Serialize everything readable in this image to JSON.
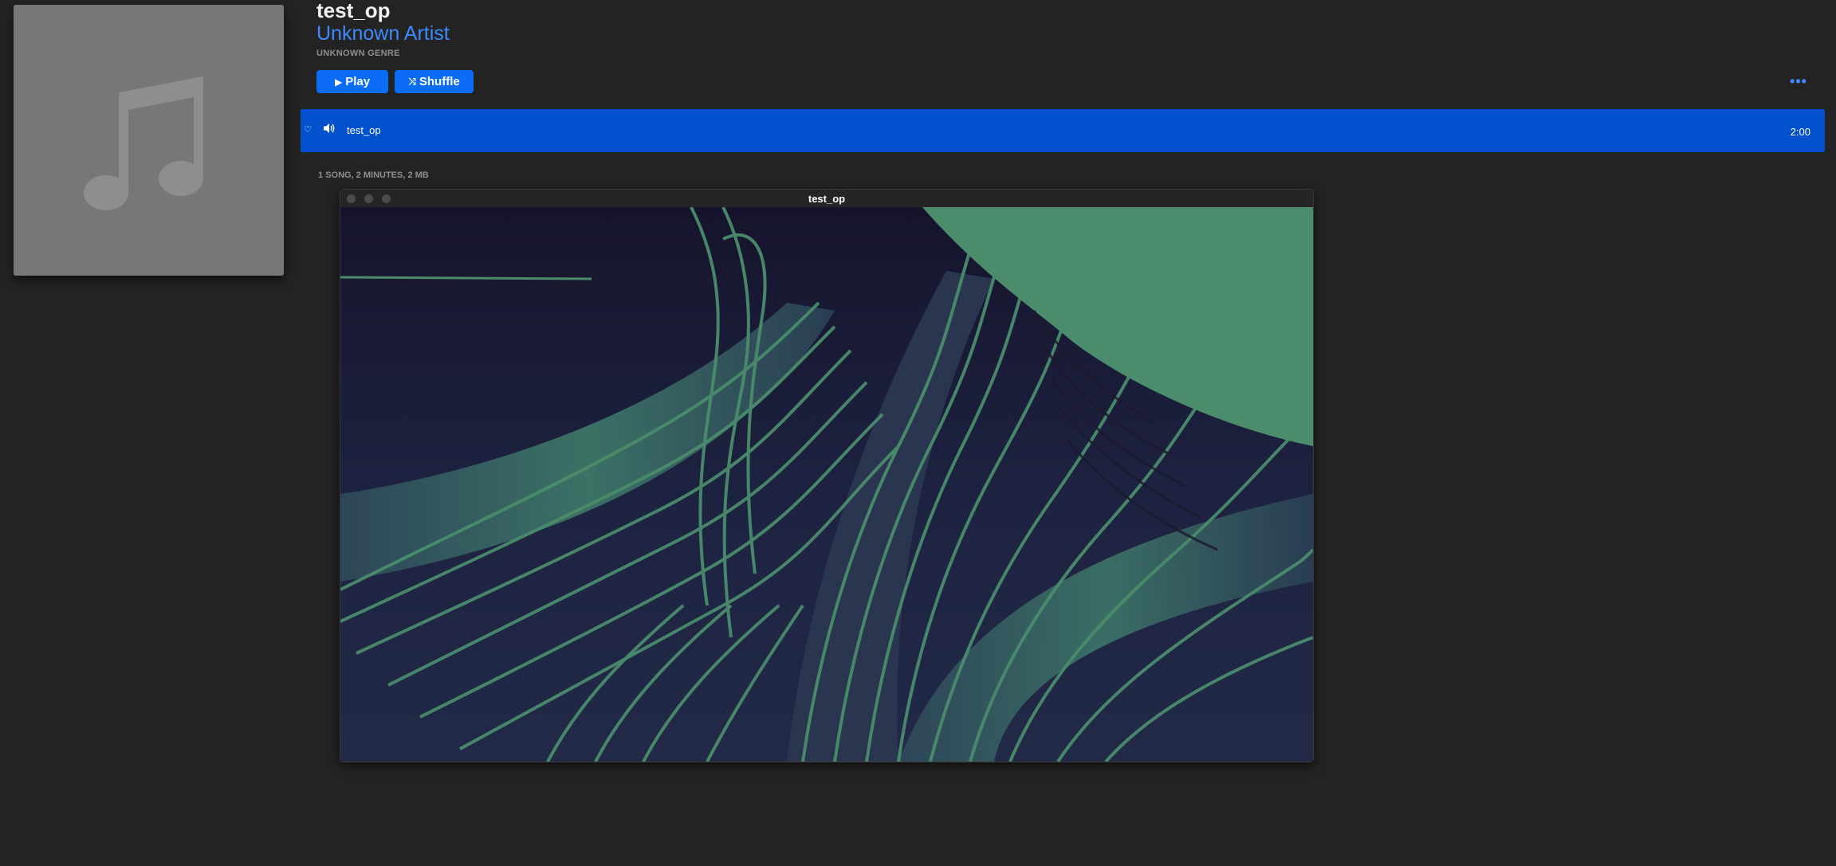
{
  "album": {
    "title": "test_op",
    "artist": "Unknown Artist",
    "genre": "UNKNOWN GENRE",
    "artwork_icon": "music-note-icon"
  },
  "controls": {
    "play_label": "Play",
    "play_icon": "▶",
    "shuffle_label": "Shuffle",
    "shuffle_icon": "⤨",
    "more_label": "•••"
  },
  "tracklist": {
    "rows": [
      {
        "heart": "♡",
        "name": "test_op",
        "duration": "2:00"
      }
    ]
  },
  "summary": "1 SONG, 2 MINUTES, 2 MB",
  "video_window": {
    "title": "test_op"
  },
  "colors": {
    "accent": "#0b6cf6",
    "selection": "#0151cf",
    "artist_link": "#3d8bff",
    "visual_green": "#4a8c6c",
    "visual_dark": "#15132a"
  }
}
